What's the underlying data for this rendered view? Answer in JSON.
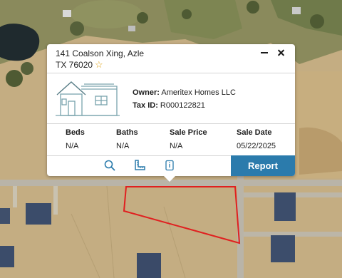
{
  "map": {
    "type": "satellite parcel map",
    "parcel_outline_color": "#e02020"
  },
  "popup": {
    "address_line1": "141 Coalson Xing, Azle",
    "address_line2": "TX 76020",
    "favorite_icon": "star-outline-icon",
    "minimize_icon": "minimize-icon",
    "close_icon": "close-icon",
    "owner_label": "Owner:",
    "owner_value": "Ameritex Homes LLC",
    "taxid_label": "Tax ID:",
    "taxid_value": "R000122821",
    "stats": [
      {
        "label": "Beds",
        "value": "N/A"
      },
      {
        "label": "Baths",
        "value": "N/A"
      },
      {
        "label": "Sale Price",
        "value": "N/A"
      },
      {
        "label": "Sale Date",
        "value": "05/22/2025"
      }
    ],
    "tools": [
      "search-icon",
      "measure-icon",
      "info-document-icon"
    ],
    "report_label": "Report",
    "accent_color": "#2b7bac",
    "star_color": "#e0a417"
  }
}
